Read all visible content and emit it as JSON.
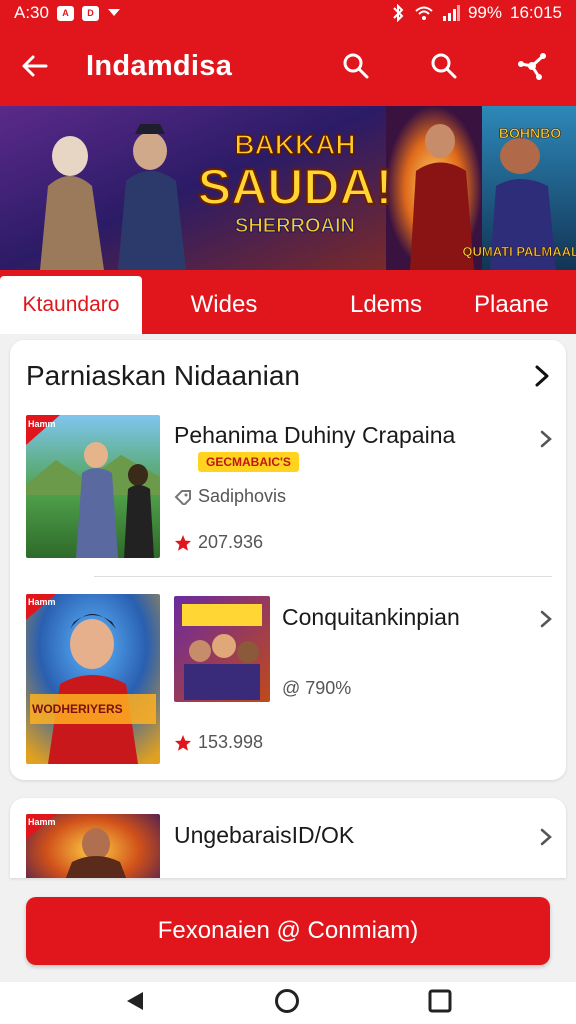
{
  "status_bar": {
    "time_left": "A:30",
    "battery": "99%",
    "clock": "16:015"
  },
  "app_bar": {
    "title": "Indamdisa"
  },
  "banner": {
    "headline_1": "BAKKAH",
    "headline_2": "SAUDA!",
    "headline_3": "SHERROAIN",
    "right_tag_1": "BOHNBO",
    "right_tag_2": "QUMATI PALMAALS"
  },
  "tabs": [
    {
      "label": "Ktaundaro",
      "active": true
    },
    {
      "label": "Wides",
      "active": false
    },
    {
      "label": "Ldems",
      "active": false
    },
    {
      "label": "Plaane",
      "active": false
    }
  ],
  "section": {
    "title": "Parniaskan Nidaanian"
  },
  "items": [
    {
      "title": "Pehanima Duhiny Crapaina",
      "badge": "GECMABAIC'S",
      "meta": "Sadiphovis",
      "rating": "207.936",
      "corner_tag": "Hamm"
    },
    {
      "title": "Conquitankinpian",
      "meta": "@ 790%",
      "rating": "153.998",
      "corner_tag": "Hamm",
      "thumb_text": "WODHERIYERS"
    },
    {
      "title": "UngebaraisID/OK",
      "rating": "",
      "corner_tag": "Hamm"
    }
  ],
  "cta": {
    "label": "Fexonaien @ Conmiam)"
  },
  "colors": {
    "brand_red": "#e0161c",
    "badge_yellow": "#ffd320",
    "star_red": "#e0161c"
  }
}
